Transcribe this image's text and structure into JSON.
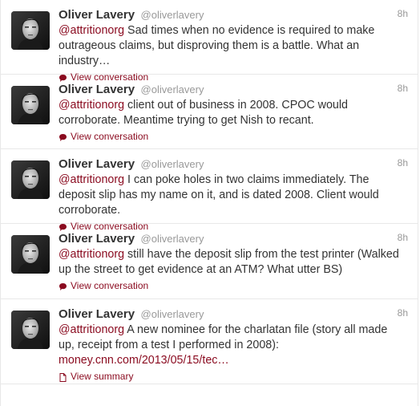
{
  "colors": {
    "link": "#8a0a1f",
    "muted": "#999999",
    "text": "#333333",
    "divider": "#e8e8e8"
  },
  "tweets": [
    {
      "fullname": "Oliver Lavery",
      "username": "@oliverlavery",
      "time": "8h",
      "mention": "@attritionorg",
      "text": " Sad times when no evidence is required to make outrageous claims, but disproving them is a battle. What an industry…",
      "url": "",
      "action_icon": "speech-bubble-icon",
      "action_label": "View conversation"
    },
    {
      "fullname": "Oliver Lavery",
      "username": "@oliverlavery",
      "time": "8h",
      "mention": "@attritionorg",
      "text": " client out of business in 2008. CPOC would corroborate. Meantime trying to get Nish to recant.",
      "url": "",
      "action_icon": "speech-bubble-icon",
      "action_label": "View conversation"
    },
    {
      "fullname": "Oliver Lavery",
      "username": "@oliverlavery",
      "time": "8h",
      "mention": "@attritionorg",
      "text": " I can poke holes in two claims immediately. The deposit slip has my name on it, and is dated 2008.  Client would corroborate.",
      "url": "",
      "action_icon": "speech-bubble-icon",
      "action_label": "View conversation"
    },
    {
      "fullname": "Oliver Lavery",
      "username": "@oliverlavery",
      "time": "8h",
      "mention": "@attritionorg",
      "text": " still have the deposit slip from the test printer (Walked up the street to get evidence at an ATM? What utter BS)",
      "url": "",
      "action_icon": "speech-bubble-icon",
      "action_label": "View conversation"
    },
    {
      "fullname": "Oliver Lavery",
      "username": "@oliverlavery",
      "time": "8h",
      "mention": "@attritionorg",
      "text": " A new nominee for the charlatan file (story all made up, receipt from a test I performed in 2008):",
      "url": "money.cnn.com/2013/05/15/tec…",
      "action_icon": "document-icon",
      "action_label": "View summary"
    }
  ]
}
